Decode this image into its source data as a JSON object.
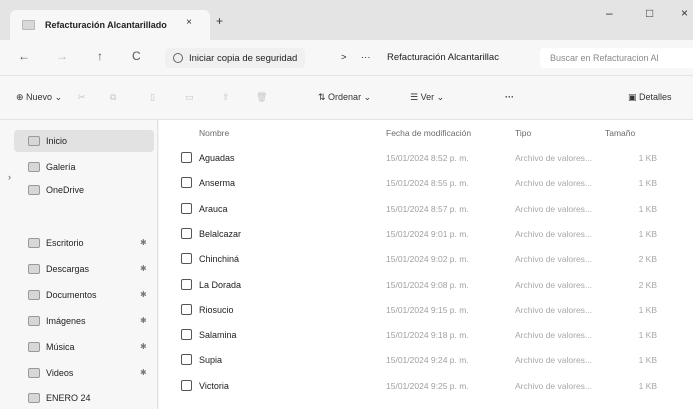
{
  "tab": {
    "title": "Refacturación Alcantarillado",
    "close": "×",
    "new_tab": "+"
  },
  "window": {
    "minimize": "–",
    "maximize": "□",
    "close": "×"
  },
  "address": {
    "back": "←",
    "forward": "→",
    "up": "↑",
    "refresh": "C",
    "backup_label": "Iniciar copia de seguridad",
    "sep": ">",
    "more": "···",
    "path": "Refacturación Alcantarillac",
    "search_placeholder": "Buscar en Refacturacion Al"
  },
  "toolbar": {
    "new_label": "Nuevo",
    "sort_label": "Ordenar",
    "view_label": "Ver",
    "more_label": "···",
    "details_label": "Detalles"
  },
  "nav": {
    "items": [
      {
        "label": "Inicio",
        "icon": "home-icon"
      },
      {
        "label": "Galería",
        "icon": "gallery-icon"
      },
      {
        "label": "OneDrive",
        "icon": "cloud-icon"
      },
      {
        "label": "Escritorio",
        "icon": "desktop-icon"
      },
      {
        "label": "Descargas",
        "icon": "download-icon"
      },
      {
        "label": "Documentos",
        "icon": "documents-icon"
      },
      {
        "label": "Imágenes",
        "icon": "pictures-icon"
      },
      {
        "label": "Música",
        "icon": "music-icon"
      },
      {
        "label": "Videos",
        "icon": "videos-icon"
      },
      {
        "label": "ENERO 24",
        "icon": "folder-icon"
      }
    ]
  },
  "columns": {
    "name": "Nombre",
    "date": "Fecha de modificación",
    "type": "Tipo",
    "size": "Tamaño"
  },
  "files": [
    {
      "name": "Aguadas",
      "date": "15/01/2024 8:52 p. m.",
      "type": "Archivo de valores...",
      "size": "1 KB"
    },
    {
      "name": "Anserma",
      "date": "15/01/2024 8:55 p. m.",
      "type": "Archivo de valores...",
      "size": "1 KB"
    },
    {
      "name": "Arauca",
      "date": "15/01/2024 8:57 p. m.",
      "type": "Archivo de valores...",
      "size": "1 KB"
    },
    {
      "name": "Belalcazar",
      "date": "15/01/2024 9:01 p. m.",
      "type": "Archivo de valores...",
      "size": "1 KB"
    },
    {
      "name": "Chinchiná",
      "date": "15/01/2024 9:02 p. m.",
      "type": "Archivo de valores...",
      "size": "2 KB"
    },
    {
      "name": "La Dorada",
      "date": "15/01/2024 9:08 p. m.",
      "type": "Archivo de valores...",
      "size": "2 KB"
    },
    {
      "name": "Riosucio",
      "date": "15/01/2024 9:15 p. m.",
      "type": "Archivo de valores...",
      "size": "1 KB"
    },
    {
      "name": "Salamina",
      "date": "15/01/2024 9:18 p. m.",
      "type": "Archivo de valores...",
      "size": "1 KB"
    },
    {
      "name": "Supia",
      "date": "15/01/2024 9:24 p. m.",
      "type": "Archivo de valores...",
      "size": "1 KB"
    },
    {
      "name": "Victoria",
      "date": "15/01/2024 9:25 p. m.",
      "type": "Archivo de valores...",
      "size": "1 KB"
    }
  ]
}
